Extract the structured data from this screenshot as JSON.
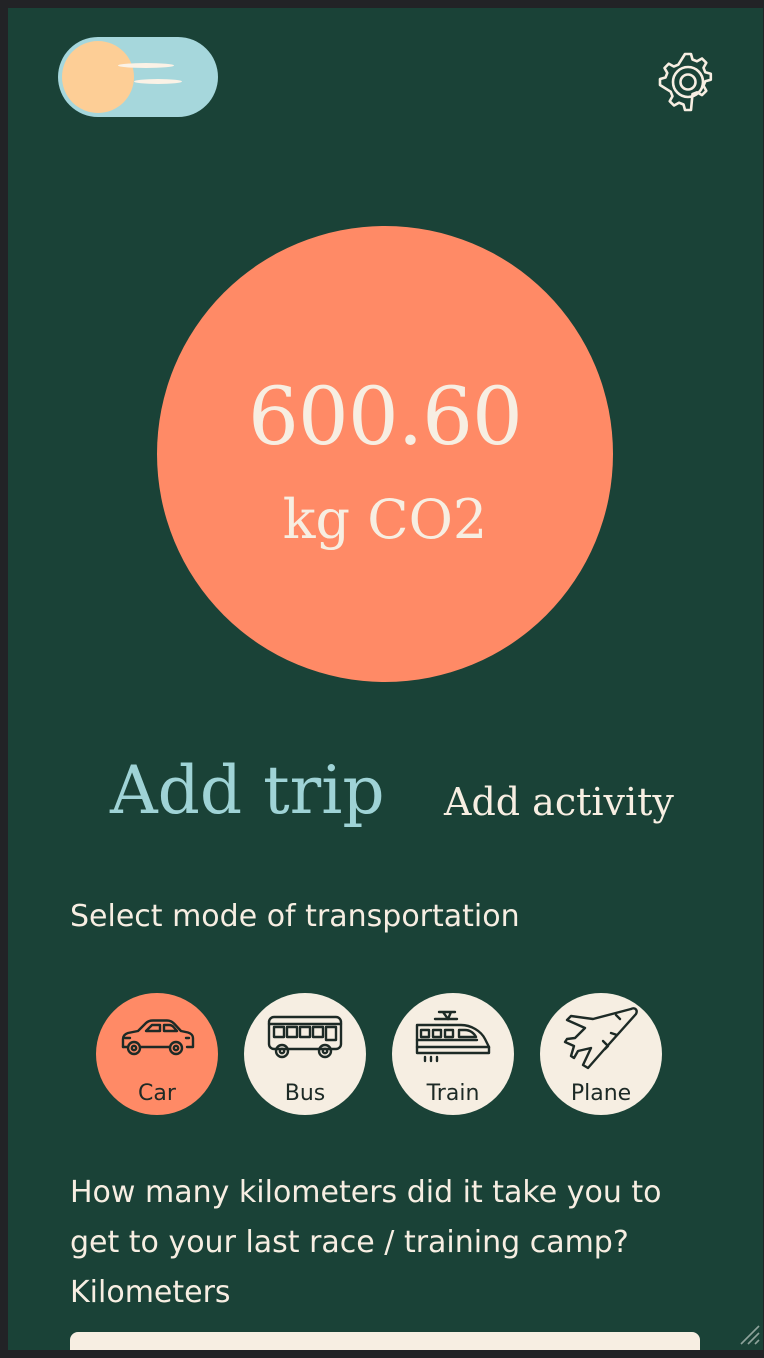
{
  "header": {
    "theme_toggle_icon": "moon-sun-toggle-icon",
    "settings_icon": "gear-icon"
  },
  "summary": {
    "total_value": "600.60",
    "unit": "kg CO2"
  },
  "tabs": {
    "trip": "Add trip",
    "activity": "Add activity",
    "active": "trip"
  },
  "transport": {
    "prompt": "Select mode of transportation",
    "selected": "Car",
    "modes": [
      {
        "label": "Car",
        "icon": "car-icon"
      },
      {
        "label": "Bus",
        "icon": "bus-icon"
      },
      {
        "label": "Train",
        "icon": "train-icon"
      },
      {
        "label": "Plane",
        "icon": "plane-icon"
      }
    ]
  },
  "distance": {
    "question": "How many kilometers did it take you to get to your last race / training camp?",
    "field_label": "Kilometers",
    "value": ""
  },
  "colors": {
    "background": "#1a4237",
    "accent": "#ff8a66",
    "teal": "#9fd3d6",
    "cream": "#f7eee2"
  }
}
